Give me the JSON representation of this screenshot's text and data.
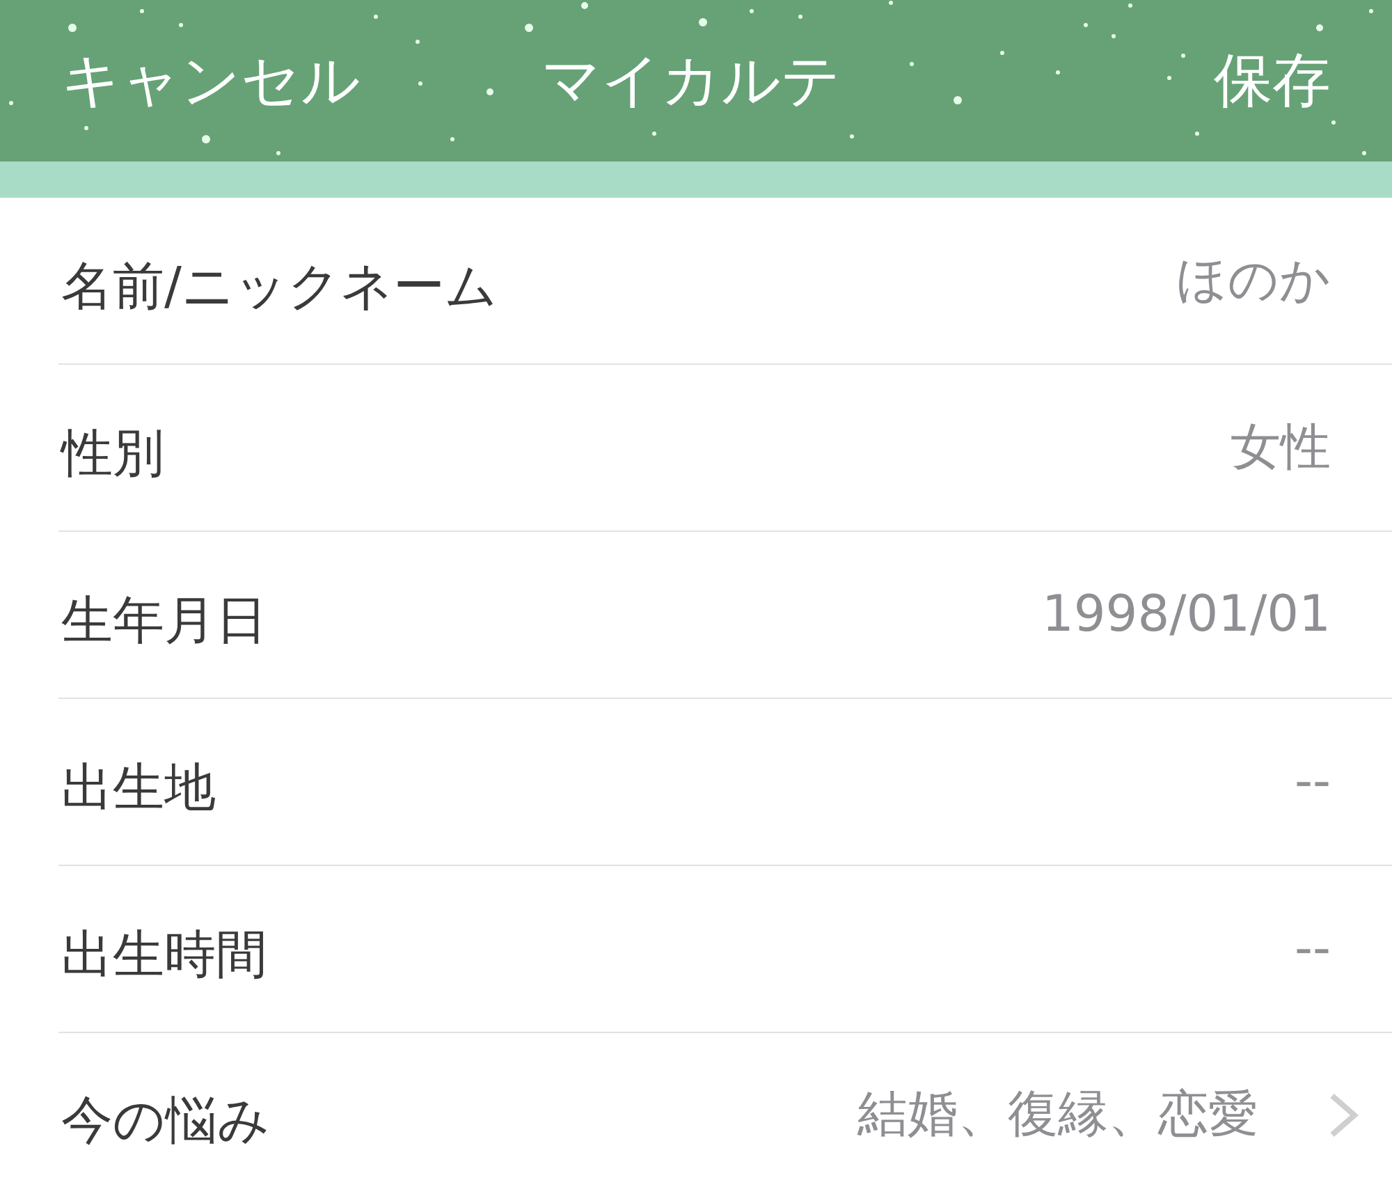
{
  "header": {
    "cancel": "キャンセル",
    "title": "マイカルテ",
    "save": "保存"
  },
  "rows": [
    {
      "label": "名前/ニックネーム",
      "value": "ほのか",
      "chevron": false
    },
    {
      "label": "性別",
      "value": "女性",
      "chevron": false
    },
    {
      "label": "生年月日",
      "value": "1998/01/01",
      "chevron": false
    },
    {
      "label": "出生地",
      "value": "--",
      "chevron": false
    },
    {
      "label": "出生時間",
      "value": "--",
      "chevron": false
    },
    {
      "label": "今の悩み",
      "value": "結婚、復縁、恋愛",
      "chevron": true
    }
  ]
}
